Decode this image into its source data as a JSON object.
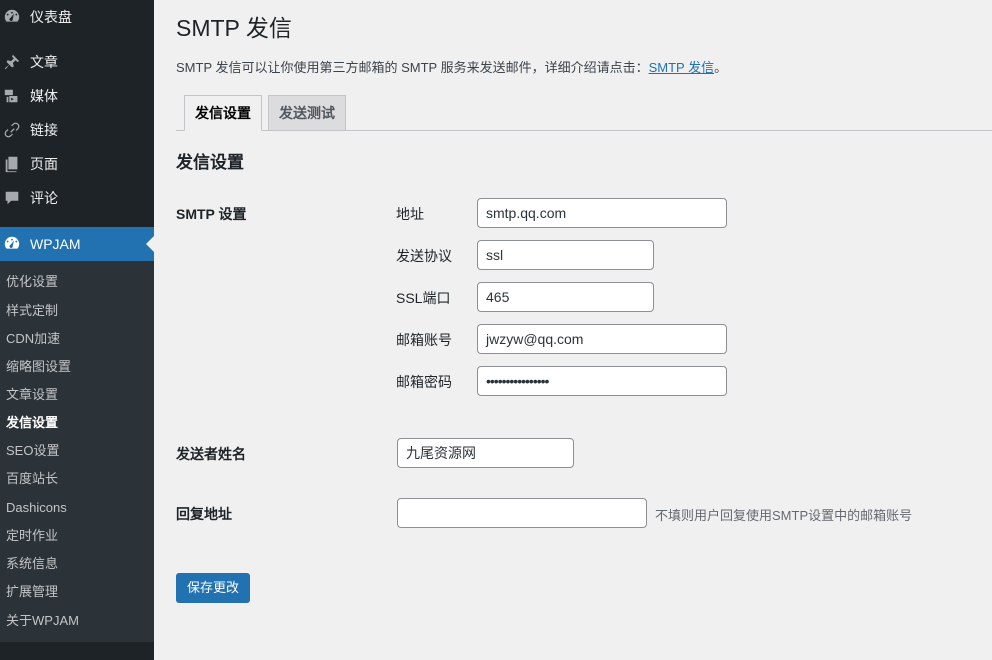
{
  "sidebar": {
    "menu": [
      {
        "label": "仪表盘",
        "icon": "dashboard-icon"
      },
      {
        "label": "文章",
        "icon": "pin-icon"
      },
      {
        "label": "媒体",
        "icon": "media-icon"
      },
      {
        "label": "链接",
        "icon": "link-icon"
      },
      {
        "label": "页面",
        "icon": "page-icon"
      },
      {
        "label": "评论",
        "icon": "comment-icon"
      },
      {
        "label": "WPJAM",
        "icon": "dashboard-icon"
      }
    ],
    "submenu": [
      "优化设置",
      "样式定制",
      "CDN加速",
      "缩略图设置",
      "文章设置",
      "发信设置",
      "SEO设置",
      "百度站长",
      "Dashicons",
      "定时作业",
      "系统信息",
      "扩展管理",
      "关于WPJAM"
    ],
    "active_submenu": "发信设置"
  },
  "page": {
    "title": "SMTP 发信",
    "description": "SMTP 发信可以让你使用第三方邮箱的 SMTP 服务来发送邮件，详细介绍请点击：",
    "description_link": "SMTP 发信",
    "description_end": "。"
  },
  "tabs": [
    {
      "label": "发信设置",
      "active": true
    },
    {
      "label": "发送测试",
      "active": false
    }
  ],
  "section_title": "发信设置",
  "smtp": {
    "row_label": "SMTP 设置",
    "fields": {
      "host_label": "地址",
      "host_value": "smtp.qq.com",
      "protocol_label": "发送协议",
      "protocol_value": "ssl",
      "port_label": "SSL端口",
      "port_value": "465",
      "account_label": "邮箱账号",
      "account_value": "jwzyw@qq.com",
      "password_label": "邮箱密码",
      "password_value": "••••••••••••••••"
    }
  },
  "sender": {
    "label": "发送者姓名",
    "value": "九尾资源网"
  },
  "reply": {
    "label": "回复地址",
    "value": "",
    "hint": "不填则用户回复使用SMTP设置中的邮箱账号"
  },
  "save_button": "保存更改",
  "colors": {
    "sidebar": "#1d2327",
    "submenu": "#2c3338",
    "accent": "#2271b1",
    "background": "#f0f0f1"
  }
}
